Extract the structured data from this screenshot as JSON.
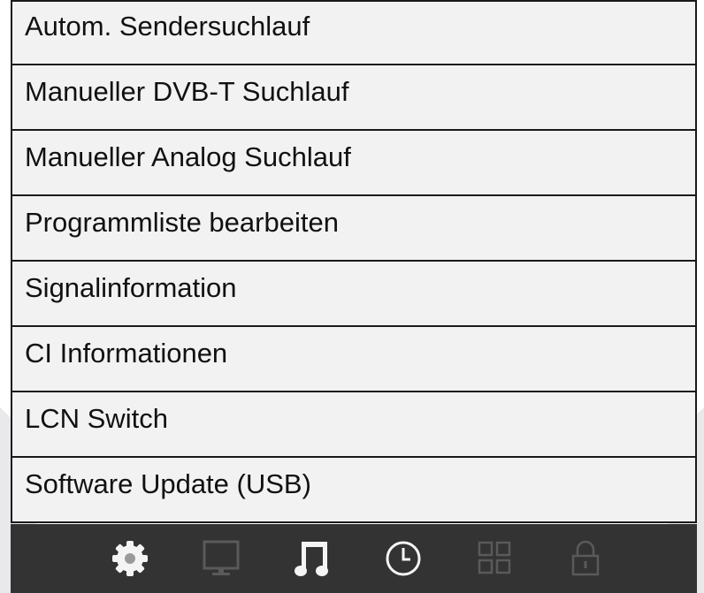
{
  "menu": {
    "items": [
      {
        "label": "Autom. Sendersuchlauf"
      },
      {
        "label": "Manueller DVB-T Suchlauf"
      },
      {
        "label": "Manueller Analog Suchlauf"
      },
      {
        "label": "Programmliste bearbeiten"
      },
      {
        "label": "Signalinformation"
      },
      {
        "label": "CI Informationen"
      },
      {
        "label": "LCN Switch"
      },
      {
        "label": "Software Update (USB)"
      }
    ]
  },
  "tabbar": {
    "tabs": [
      {
        "icon": "gear-icon",
        "active": true
      },
      {
        "icon": "monitor-icon",
        "active": false
      },
      {
        "icon": "music-note-icon",
        "active": true
      },
      {
        "icon": "clock-icon",
        "active": true
      },
      {
        "icon": "grid-icon",
        "active": false
      },
      {
        "icon": "lock-icon",
        "active": false
      }
    ]
  },
  "colors": {
    "menu_bg": "#f2f2f2",
    "border": "#1a1a1a",
    "tabbar_bg": "#333333",
    "icon_active": "#f4f4f4",
    "icon_inactive": "#5a5a5a"
  }
}
